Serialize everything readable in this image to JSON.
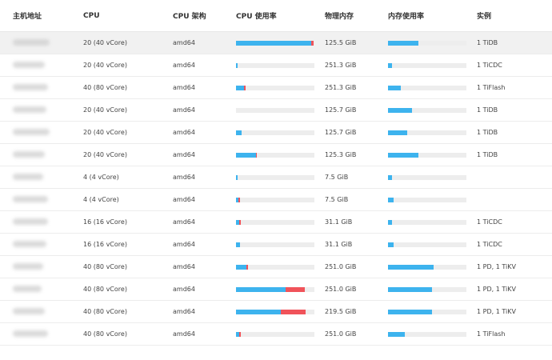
{
  "colors": {
    "cpu_used": "#3db3ee",
    "cpu_over": "#f0535a",
    "mem_used": "#3db3ee",
    "track": "#ededed"
  },
  "columns": {
    "host": "主机地址",
    "cpu": "CPU",
    "arch": "CPU 架构",
    "cpu_usage": "CPU 使用率",
    "memory": "物理内存",
    "mem_usage": "内存使用率",
    "instances": "实例"
  },
  "rows": [
    {
      "cpu": "20 (40 vCore)",
      "arch": "amd64",
      "cpu_blue": 0.96,
      "cpu_red": 0.03,
      "memory": "125.5 GiB",
      "mem_usage": 0.39,
      "instances": "1 TiDB"
    },
    {
      "cpu": "20 (40 vCore)",
      "arch": "amd64",
      "cpu_blue": 0.02,
      "cpu_red": 0.0,
      "memory": "251.3 GiB",
      "mem_usage": 0.05,
      "instances": "1 TiCDC"
    },
    {
      "cpu": "40 (80 vCore)",
      "arch": "amd64",
      "cpu_blue": 0.1,
      "cpu_red": 0.02,
      "memory": "251.3 GiB",
      "mem_usage": 0.16,
      "instances": "1 TiFlash"
    },
    {
      "cpu": "20 (40 vCore)",
      "arch": "amd64",
      "cpu_blue": 0.0,
      "cpu_red": 0.0,
      "memory": "125.7 GiB",
      "mem_usage": 0.31,
      "instances": "1 TiDB"
    },
    {
      "cpu": "20 (40 vCore)",
      "arch": "amd64",
      "cpu_blue": 0.07,
      "cpu_red": 0.0,
      "memory": "125.7 GiB",
      "mem_usage": 0.24,
      "instances": "1 TiDB"
    },
    {
      "cpu": "20 (40 vCore)",
      "arch": "amd64",
      "cpu_blue": 0.25,
      "cpu_red": 0.02,
      "memory": "125.3 GiB",
      "mem_usage": 0.39,
      "instances": "1 TiDB"
    },
    {
      "cpu": "4 (4 vCore)",
      "arch": "amd64",
      "cpu_blue": 0.02,
      "cpu_red": 0.0,
      "memory": "7.5 GiB",
      "mem_usage": 0.05,
      "instances": ""
    },
    {
      "cpu": "4 (4 vCore)",
      "arch": "amd64",
      "cpu_blue": 0.03,
      "cpu_red": 0.02,
      "memory": "7.5 GiB",
      "mem_usage": 0.07,
      "instances": ""
    },
    {
      "cpu": "16 (16 vCore)",
      "arch": "amd64",
      "cpu_blue": 0.04,
      "cpu_red": 0.02,
      "memory": "31.1 GiB",
      "mem_usage": 0.05,
      "instances": "1 TiCDC"
    },
    {
      "cpu": "16 (16 vCore)",
      "arch": "amd64",
      "cpu_blue": 0.05,
      "cpu_red": 0.0,
      "memory": "31.1 GiB",
      "mem_usage": 0.07,
      "instances": "1 TiCDC"
    },
    {
      "cpu": "40 (80 vCore)",
      "arch": "amd64",
      "cpu_blue": 0.13,
      "cpu_red": 0.02,
      "memory": "251.0 GiB",
      "mem_usage": 0.58,
      "instances": "1 PD, 1 TiKV"
    },
    {
      "cpu": "40 (80 vCore)",
      "arch": "amd64",
      "cpu_blue": 0.63,
      "cpu_red": 0.25,
      "memory": "251.0 GiB",
      "mem_usage": 0.56,
      "instances": "1 PD, 1 TiKV"
    },
    {
      "cpu": "40 (80 vCore)",
      "arch": "amd64",
      "cpu_blue": 0.57,
      "cpu_red": 0.32,
      "memory": "219.5 GiB",
      "mem_usage": 0.56,
      "instances": "1 PD, 1 TiKV"
    },
    {
      "cpu": "40 (80 vCore)",
      "arch": "amd64",
      "cpu_blue": 0.04,
      "cpu_red": 0.02,
      "memory": "251.0 GiB",
      "mem_usage": 0.21,
      "instances": "1 TiFlash"
    }
  ]
}
